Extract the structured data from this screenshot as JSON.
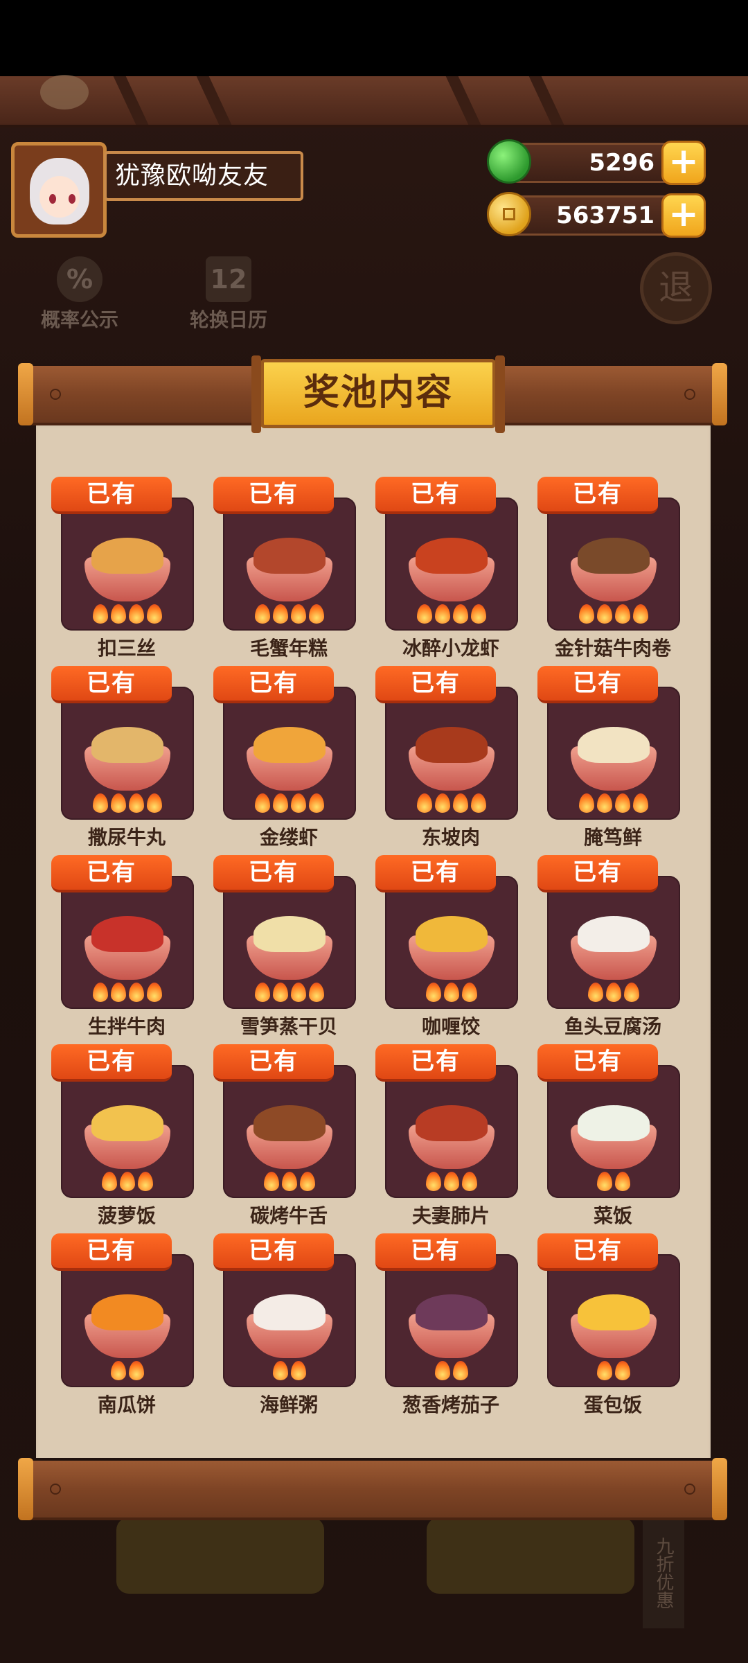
{
  "player": {
    "name": "犹豫欧呦友友"
  },
  "currencies": {
    "gems": "5296",
    "coins": "563751",
    "add_symbol": "+"
  },
  "background": {
    "probability_label": "概率公示",
    "probability_icon": "%",
    "calendar_label": "轮换日历",
    "calendar_icon": "12",
    "exit_label": "退",
    "side_tag": "九折优惠"
  },
  "modal": {
    "title": "奖池内容"
  },
  "status_owned": "已有",
  "dishes": [
    {
      "name": "扣三丝",
      "flames": 4,
      "food": "#e6a34a"
    },
    {
      "name": "毛蟹年糕",
      "flames": 4,
      "food": "#b3472c"
    },
    {
      "name": "冰醉小龙虾",
      "flames": 4,
      "food": "#c9421f"
    },
    {
      "name": "金针菇牛肉卷",
      "flames": 4,
      "food": "#7a4a2a"
    },
    {
      "name": "撒尿牛丸",
      "flames": 4,
      "food": "#e3b66a"
    },
    {
      "name": "金缕虾",
      "flames": 4,
      "food": "#f0a53a"
    },
    {
      "name": "东坡肉",
      "flames": 4,
      "food": "#a83a1c"
    },
    {
      "name": "腌笃鲜",
      "flames": 4,
      "food": "#f2e3c2"
    },
    {
      "name": "生拌牛肉",
      "flames": 4,
      "food": "#c8322a"
    },
    {
      "name": "雪笋蒸干贝",
      "flames": 4,
      "food": "#f0dfa8"
    },
    {
      "name": "咖喱饺",
      "flames": 3,
      "food": "#f0b83a"
    },
    {
      "name": "鱼头豆腐汤",
      "flames": 3,
      "food": "#f3eee8"
    },
    {
      "name": "菠萝饭",
      "flames": 3,
      "food": "#f2c24e"
    },
    {
      "name": "碳烤牛舌",
      "flames": 3,
      "food": "#8e4a26"
    },
    {
      "name": "夫妻肺片",
      "flames": 3,
      "food": "#b83c24"
    },
    {
      "name": "菜饭",
      "flames": 2,
      "food": "#eef2e6"
    },
    {
      "name": "南瓜饼",
      "flames": 2,
      "food": "#f28a22"
    },
    {
      "name": "海鲜粥",
      "flames": 2,
      "food": "#f4ece6"
    },
    {
      "name": "葱香烤茄子",
      "flames": 2,
      "food": "#6e3a5a"
    },
    {
      "name": "蛋包饭",
      "flames": 2,
      "food": "#f7c23a"
    }
  ]
}
